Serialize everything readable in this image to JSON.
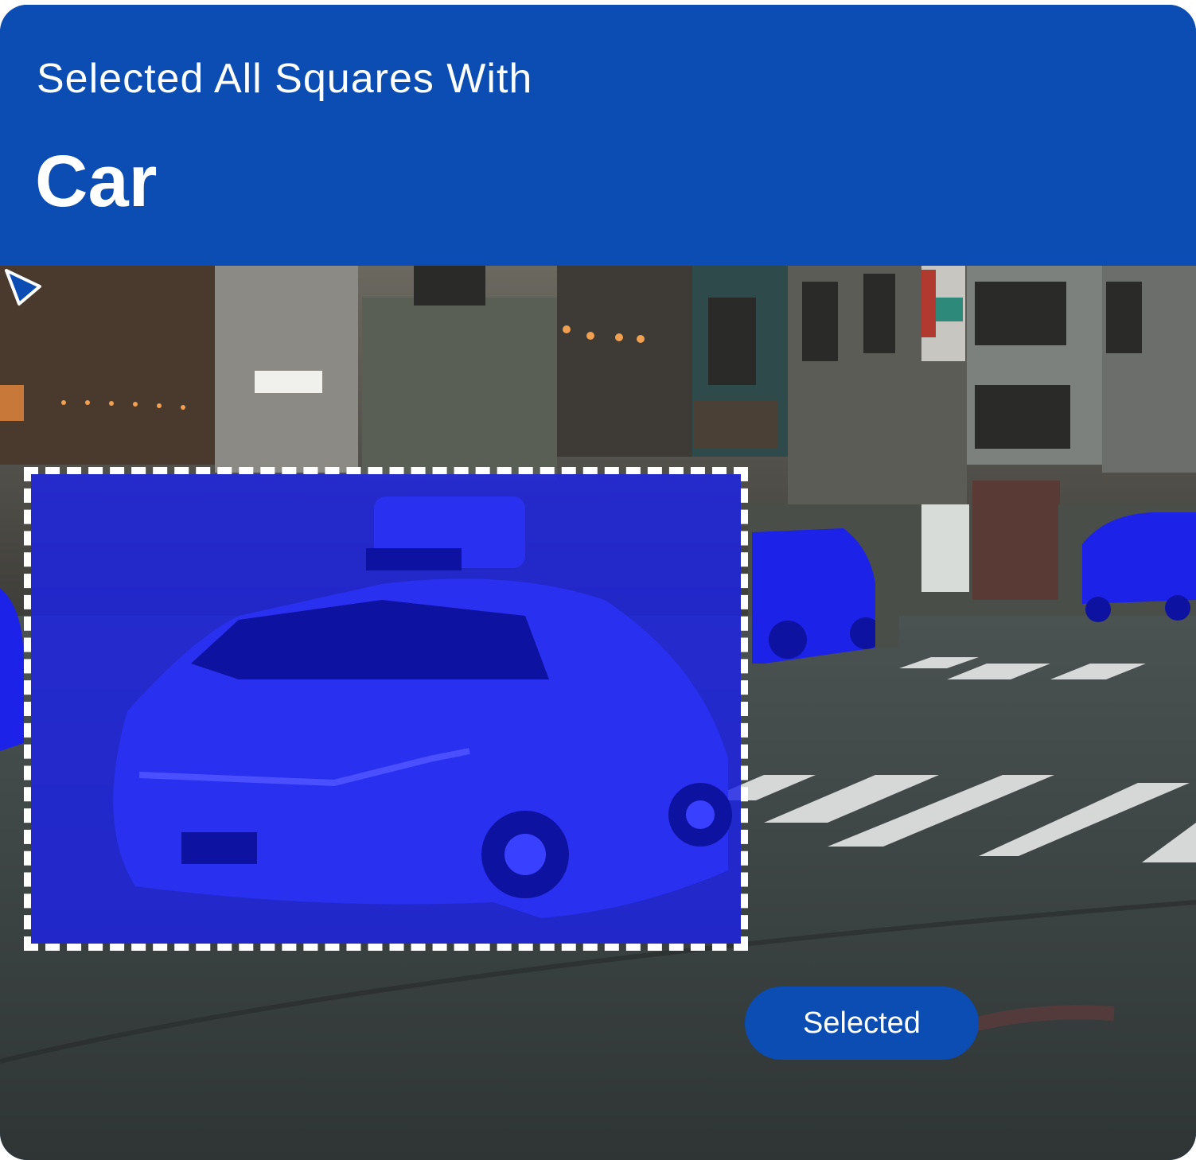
{
  "header": {
    "prompt": "Selected All Squares With",
    "target": "Car"
  },
  "scene": {
    "description_icon": "street-scene-image",
    "highlight_color": "#1c22e8",
    "brand_color": "#0b4db3"
  },
  "controls": {
    "selected_label": "Selected",
    "cursor_icon": "pointer-cursor-icon"
  }
}
